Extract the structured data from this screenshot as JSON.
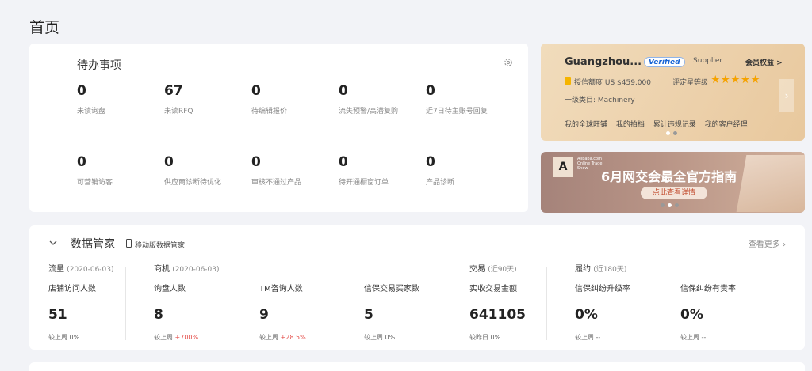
{
  "page": {
    "title": "首页"
  },
  "todo": {
    "title": "待办事项",
    "items": [
      {
        "value": "0",
        "label": "未读询盘"
      },
      {
        "value": "67",
        "label": "未读RFQ"
      },
      {
        "value": "0",
        "label": "待编辑报价"
      },
      {
        "value": "0",
        "label": "流失预警/高潜复购"
      },
      {
        "value": "0",
        "label": "近7日待主账号回复"
      },
      {
        "value": "0",
        "label": "可营销访客"
      },
      {
        "value": "0",
        "label": "供应商诊断待优化"
      },
      {
        "value": "0",
        "label": "审核不通过产品"
      },
      {
        "value": "0",
        "label": "待开通橱窗订单"
      },
      {
        "value": "0",
        "label": "产品诊断"
      }
    ]
  },
  "supplier": {
    "name": "Guangzhou...",
    "verified": "Verified",
    "type": "Supplier",
    "member_link": "会员权益 >",
    "credit": "授信额度 US $459,000",
    "rating_label": "评定星等级",
    "stars": "★★★★★",
    "category": "一级类目: Machinery",
    "links": [
      "我的全球旺铺",
      "我的拍档",
      "累计违规记录",
      "我的客户经理"
    ],
    "next": "›"
  },
  "banner": {
    "logo": "A",
    "small_text": "Alibaba.com Online Trade Show",
    "title": "6月网交会最全官方指南",
    "button": "点此查看详情"
  },
  "data_manager": {
    "title": "数据管家",
    "mobile_link": "移动版数据管家",
    "more": "查看更多 ›",
    "groups": [
      {
        "name": "流量",
        "date": "(2020-06-03)"
      },
      {
        "name": "商机",
        "date": "(2020-06-03)"
      },
      {
        "name": "交易",
        "date": "(近90天)"
      },
      {
        "name": "履约",
        "date": "(近180天)"
      }
    ],
    "metrics": [
      {
        "label": "店铺访问人数",
        "value": "51",
        "cmp_label": "较上周",
        "cmp_value": "0%",
        "up": false
      },
      {
        "label": "询盘人数",
        "value": "8",
        "cmp_label": "较上周",
        "cmp_value": "+700%",
        "up": true
      },
      {
        "label": "TM咨询人数",
        "value": "9",
        "cmp_label": "较上周",
        "cmp_value": "+28.5%",
        "up": true
      },
      {
        "label": "信保交易买家数",
        "value": "5",
        "cmp_label": "较上周",
        "cmp_value": "0%",
        "up": false
      },
      {
        "label": "实收交易金额",
        "value": "641105",
        "cmp_label": "较昨日",
        "cmp_value": "0%",
        "up": false
      },
      {
        "label": "信保纠纷升级率",
        "value": "0%",
        "cmp_label": "较上周",
        "cmp_value": "--",
        "up": false
      },
      {
        "label": "信保纠纷有责率",
        "value": "0%",
        "cmp_label": "较上周",
        "cmp_value": "--",
        "up": false
      }
    ]
  },
  "colors": {
    "accent_red": "#e5504c",
    "gold": "#f5a200",
    "verified_blue": "#1a66d6"
  }
}
